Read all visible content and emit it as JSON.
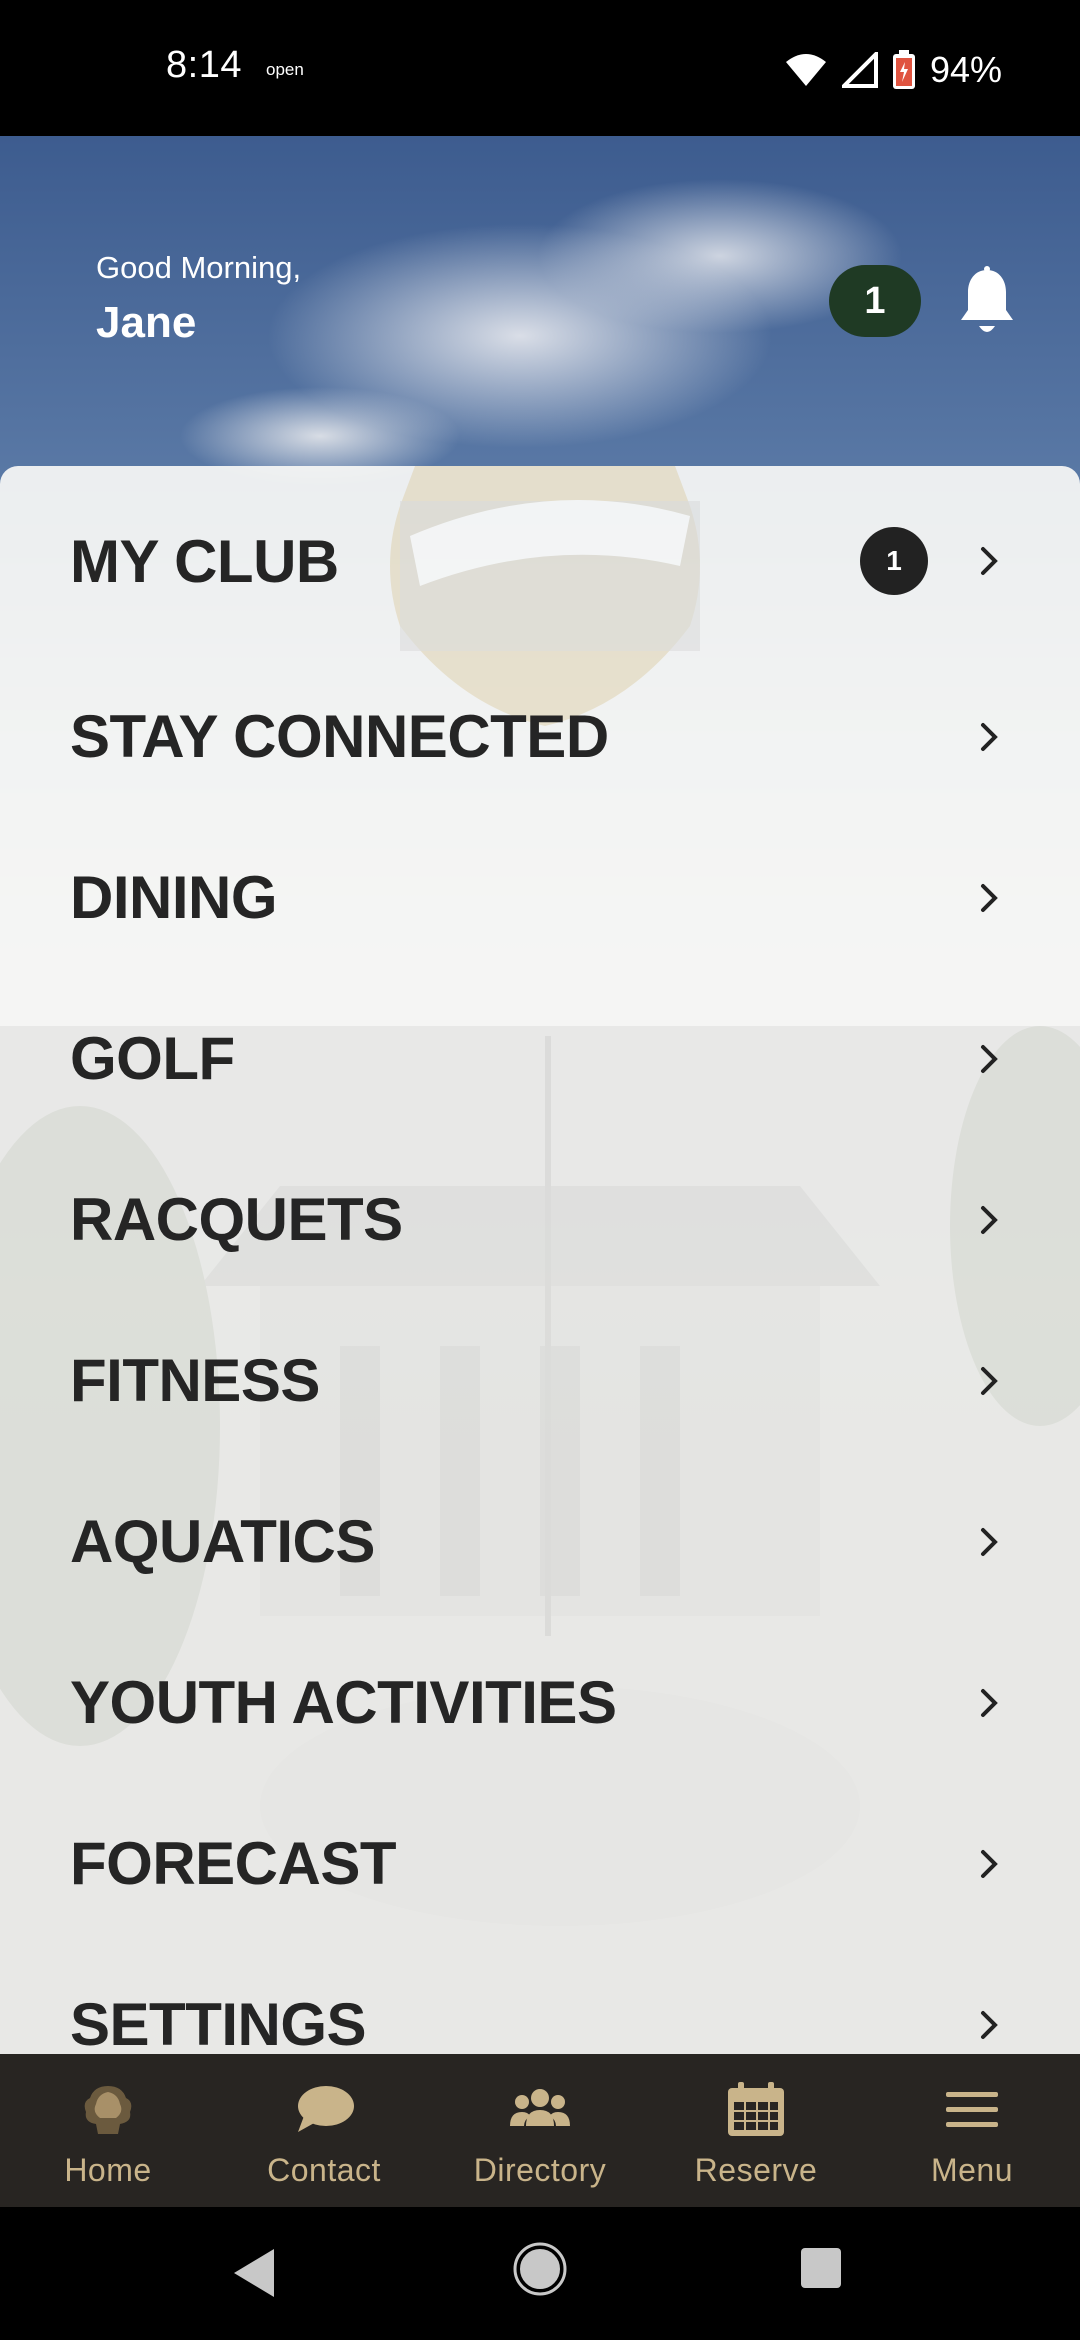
{
  "status_bar": {
    "time": "8:14",
    "carrier_text": "open",
    "battery_percent": "94%",
    "icons": [
      "wifi-icon",
      "signal-icon",
      "battery-icon"
    ]
  },
  "header": {
    "greeting": "Good Morning,",
    "user_name": "Jane",
    "notification_count": "1",
    "bell_icon": "bell-icon"
  },
  "menu": {
    "items": [
      {
        "label": "MY CLUB",
        "badge": "1"
      },
      {
        "label": "STAY CONNECTED"
      },
      {
        "label": "DINING"
      },
      {
        "label": "GOLF"
      },
      {
        "label": "RACQUETS"
      },
      {
        "label": "FITNESS"
      },
      {
        "label": "AQUATICS"
      },
      {
        "label": "YOUTH ACTIVITIES"
      },
      {
        "label": "FORECAST"
      },
      {
        "label": "SETTINGS"
      }
    ]
  },
  "tabbar": {
    "tabs": [
      {
        "label": "Home",
        "icon": "club-logo-icon"
      },
      {
        "label": "Contact",
        "icon": "chat-bubble-icon"
      },
      {
        "label": "Directory",
        "icon": "people-icon"
      },
      {
        "label": "Reserve",
        "icon": "calendar-icon"
      },
      {
        "label": "Menu",
        "icon": "hamburger-icon"
      }
    ]
  },
  "colors": {
    "tab_accent": "#c9b48a",
    "tab_background": "#282522",
    "badge_green": "#1f3a24",
    "menu_text": "#252525"
  }
}
